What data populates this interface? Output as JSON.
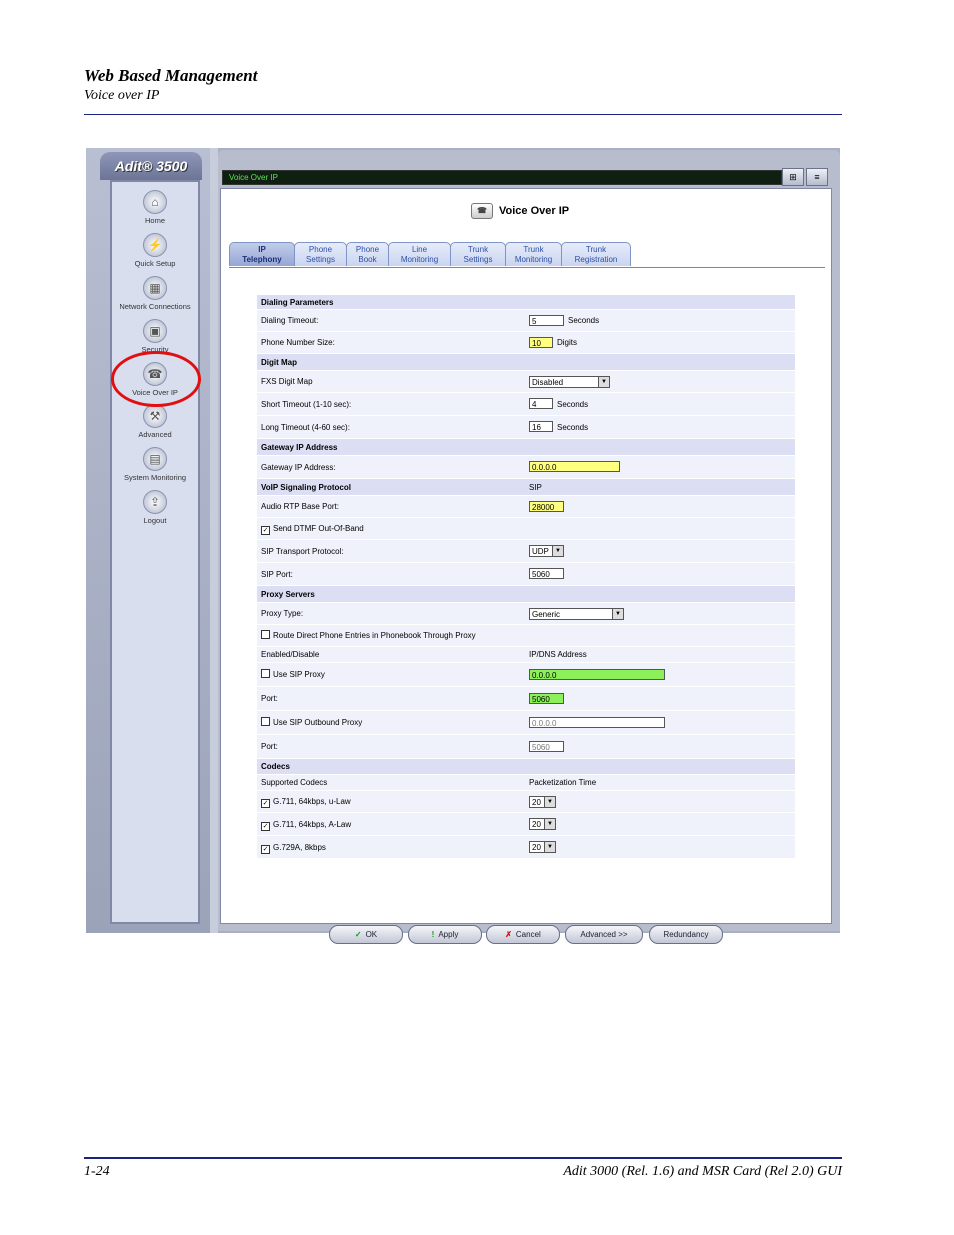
{
  "doc": {
    "title": "Web Based Management",
    "subtitle": "Voice over IP",
    "page_number": "1-24",
    "footer": "Adit 3000 (Rel. 1.6) and MSR Card (Rel 2.0) GUI"
  },
  "app": {
    "brand": "Adit® 3500",
    "address_bar": "Voice Over IP",
    "page_heading": "Voice Over IP"
  },
  "nav": [
    {
      "label": "Home",
      "icon": "home-icon"
    },
    {
      "label": "Quick Setup",
      "icon": "lightning-icon"
    },
    {
      "label": "Network Connections",
      "icon": "network-icon"
    },
    {
      "label": "Security",
      "icon": "lock-icon"
    },
    {
      "label": "Voice Over IP",
      "icon": "phone-icon"
    },
    {
      "label": "Advanced",
      "icon": "tools-icon"
    },
    {
      "label": "System Monitoring",
      "icon": "monitor-icon"
    },
    {
      "label": "Logout",
      "icon": "logout-icon"
    }
  ],
  "tabs": [
    {
      "line1": "IP",
      "line2": "Telephony"
    },
    {
      "line1": "Phone",
      "line2": "Settings"
    },
    {
      "line1": "Phone",
      "line2": "Book"
    },
    {
      "line1": "Line",
      "line2": "Monitoring"
    },
    {
      "line1": "Trunk",
      "line2": "Settings"
    },
    {
      "line1": "Trunk",
      "line2": "Monitoring"
    },
    {
      "line1": "Trunk",
      "line2": "Registration"
    }
  ],
  "form": {
    "dialing_parameters": "Dialing Parameters",
    "dialing_timeout_label": "Dialing Timeout:",
    "dialing_timeout_value": "5",
    "dialing_timeout_unit": "Seconds",
    "phone_number_size_label": "Phone Number Size:",
    "phone_number_size_value": "10",
    "phone_number_size_unit": "Digits",
    "digit_map": "Digit Map",
    "fxs_digit_map_label": "FXS Digit Map",
    "fxs_digit_map_value": "Disabled",
    "short_timeout_label": "Short Timeout (1-10 sec):",
    "short_timeout_value": "4",
    "short_timeout_unit": "Seconds",
    "long_timeout_label": "Long Timeout (4-60 sec):",
    "long_timeout_value": "16",
    "long_timeout_unit": "Seconds",
    "gateway_ip_address": "Gateway IP Address",
    "gateway_ip_label": "Gateway IP Address:",
    "gateway_ip_value": "0.0.0.0",
    "voip_signaling_protocol": "VoIP Signaling Protocol",
    "voip_signaling_value": "SIP",
    "audio_rtp_label": "Audio RTP Base Port:",
    "audio_rtp_value": "28000",
    "send_dtmf_label": "Send DTMF Out-Of-Band",
    "sip_transport_label": "SIP Transport Protocol:",
    "sip_transport_value": "UDP",
    "sip_port_label": "SIP Port:",
    "sip_port_value": "5060",
    "proxy_servers": "Proxy Servers",
    "proxy_type_label": "Proxy Type:",
    "proxy_type_value": "Generic",
    "route_direct_label": "Route Direct Phone Entries in Phonebook Through Proxy",
    "enabled_disable": "Enabled/Disable",
    "ip_dns_address": "IP/DNS Address",
    "use_sip_proxy_label": "Use SIP Proxy",
    "use_sip_proxy_value": "0.0.0.0",
    "port_label": "Port:",
    "sip_proxy_port_value": "5060",
    "use_sip_outbound_label": "Use SIP Outbound Proxy",
    "sip_outbound_value": "0.0.0.0",
    "outbound_port_value": "5060",
    "codecs": "Codecs",
    "supported_codecs": "Supported Codecs",
    "packetization_time": "Packetization Time",
    "codec_rows": [
      {
        "name": "G.711, 64kbps, u-Law",
        "ptime": "20"
      },
      {
        "name": "G.711, 64kbps, A-Law",
        "ptime": "20"
      },
      {
        "name": "G.729A, 8kbps",
        "ptime": "20"
      }
    ]
  },
  "buttons": {
    "ok": "OK",
    "apply": "Apply",
    "cancel": "Cancel",
    "advanced": "Advanced >>",
    "redundancy": "Redundancy"
  },
  "colors": {
    "highlight_ring": "#e01010",
    "required_field": "#ffff80",
    "active_field": "#8cf05a"
  }
}
